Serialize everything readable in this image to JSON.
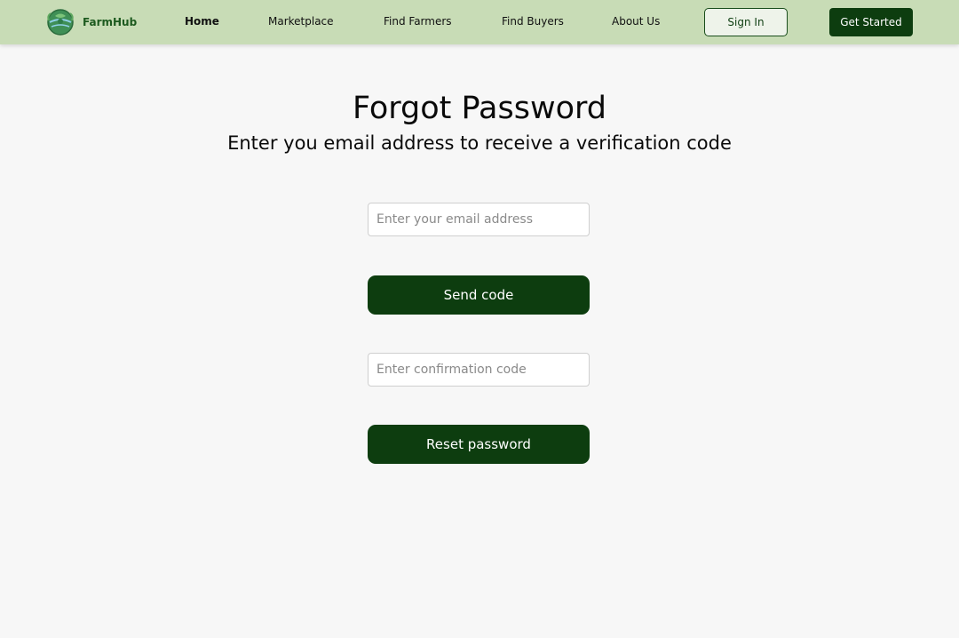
{
  "brand": {
    "name": "FarmHub",
    "logo_icon": "globe-leaf-icon",
    "name_color": "#1d5a1f"
  },
  "nav": {
    "links": [
      {
        "label": "Home",
        "active": true
      },
      {
        "label": "Marketplace",
        "active": false
      },
      {
        "label": "Find Farmers",
        "active": false
      },
      {
        "label": "Find Buyers",
        "active": false
      },
      {
        "label": "About Us",
        "active": false
      }
    ],
    "sign_in": "Sign In",
    "get_started": "Get Started"
  },
  "colors": {
    "navbar_bg": "#c8dcb6",
    "primary": "#0d3d0f",
    "page_bg": "#f7f7f7"
  },
  "form": {
    "title": "Forgot Password",
    "subtitle": "Enter you email address to receive a verification code",
    "email_placeholder": "Enter your email address",
    "send_code": "Send code",
    "code_placeholder": "Enter confirmation code",
    "reset_password": "Reset password"
  }
}
